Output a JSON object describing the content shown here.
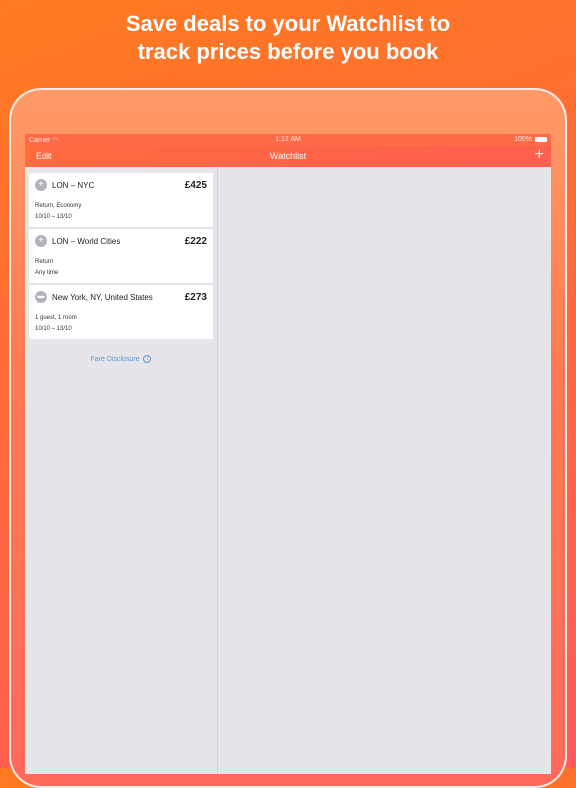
{
  "promo": {
    "line1": "Save deals to your Watchlist to",
    "line2": "track prices before you book"
  },
  "status_bar": {
    "carrier": "Carrier",
    "time": "1:12 AM",
    "battery": "100%"
  },
  "nav": {
    "edit_label": "Edit",
    "title": "Watchlist",
    "add_label": "+"
  },
  "items": [
    {
      "icon": "plane-icon",
      "route": "LON – NYC",
      "price": "£425",
      "details": "Return, Economy",
      "dates": "10/10 – 13/10"
    },
    {
      "icon": "plane-icon",
      "route": "LON – World Cities",
      "price": "£222",
      "details": "Return",
      "dates": "Any time"
    },
    {
      "icon": "bed-icon",
      "route": "New York, NY, United States",
      "price": "£273",
      "details": "1 guest, 1 room",
      "dates": "10/10 – 13/10"
    }
  ],
  "fare_disclosure": {
    "label": "Fare Disclosure",
    "icon": "info-icon"
  },
  "colors": {
    "accent": "#ff6a47",
    "link": "#5b95d6",
    "icon_gray": "#b0b3bd"
  }
}
